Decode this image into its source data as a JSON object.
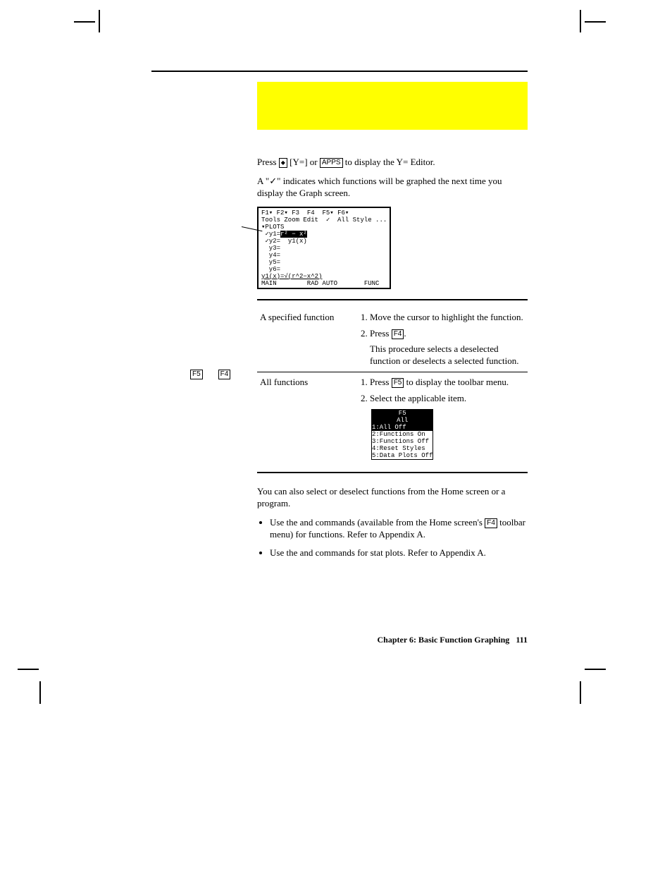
{
  "keys": {
    "diamond": "◆",
    "y_eq": "Y=",
    "apps": "APPS",
    "f4": "F4",
    "f5": "F5"
  },
  "intro": {
    "line1_a": "Press ",
    "line1_b": " [",
    "line1_c": "] or ",
    "line1_d": " to display the Y= Editor.",
    "line2_a": "A \"",
    "tick": "✓",
    "line2_b": "\" indicates which functions will be graphed the next time you display the Graph screen."
  },
  "screenshot": {
    "top": "F1▾ F2▾ F3  F4  F5▾ F6▾",
    "subtop": "Tools Zoom Edit  ✓  All Style ...",
    "plots": "▾PLOTS",
    "y1_l": " ✓y1=",
    "y1_hl": "r² − x²",
    "y2": " ✓y2=  y1(x)",
    "y3": "  y3=",
    "y4": "  y4=",
    "y5": "  y5=",
    "y6": "  y6=",
    "entry": "y1(x)=√(r^2−x^2)",
    "status": "MAIN        RAD AUTO       FUNC"
  },
  "tbl": {
    "r1c1": "A specified function",
    "r1s1": "Move the cursor to highlight the function.",
    "r1s2a": "Press ",
    "r1s2b": ".",
    "r1note": "This procedure selects a deselected function or deselects a selected function.",
    "r2c1": "All functions",
    "r2s1a": "Press ",
    "r2s1b": " to display the ",
    "r2s1c": " toolbar menu.",
    "r2s2": "Select the applicable item."
  },
  "menu": {
    "head": "F5\nAll",
    "i1": "1:All Off",
    "i2": "2:Functions On",
    "i3": "3:Functions Off",
    "i4": "4:Reset Styles",
    "i5": "5:Data Plots Off"
  },
  "after": {
    "p": "You can also select or deselect functions from the Home screen or a program.",
    "b1a": "Use the ",
    "b1b": " and ",
    "b1c": " commands (available from the Home screen's ",
    "b1d": " toolbar menu) for functions. Refer to Appendix A.",
    "b2a": "Use the ",
    "b2b": " and ",
    "b2c": " commands for stat plots. Refer to Appendix A."
  },
  "side": {
    "a": "",
    "b": ""
  },
  "footer": {
    "chap": "Chapter 6: Basic Function Graphing",
    "page": "111"
  }
}
